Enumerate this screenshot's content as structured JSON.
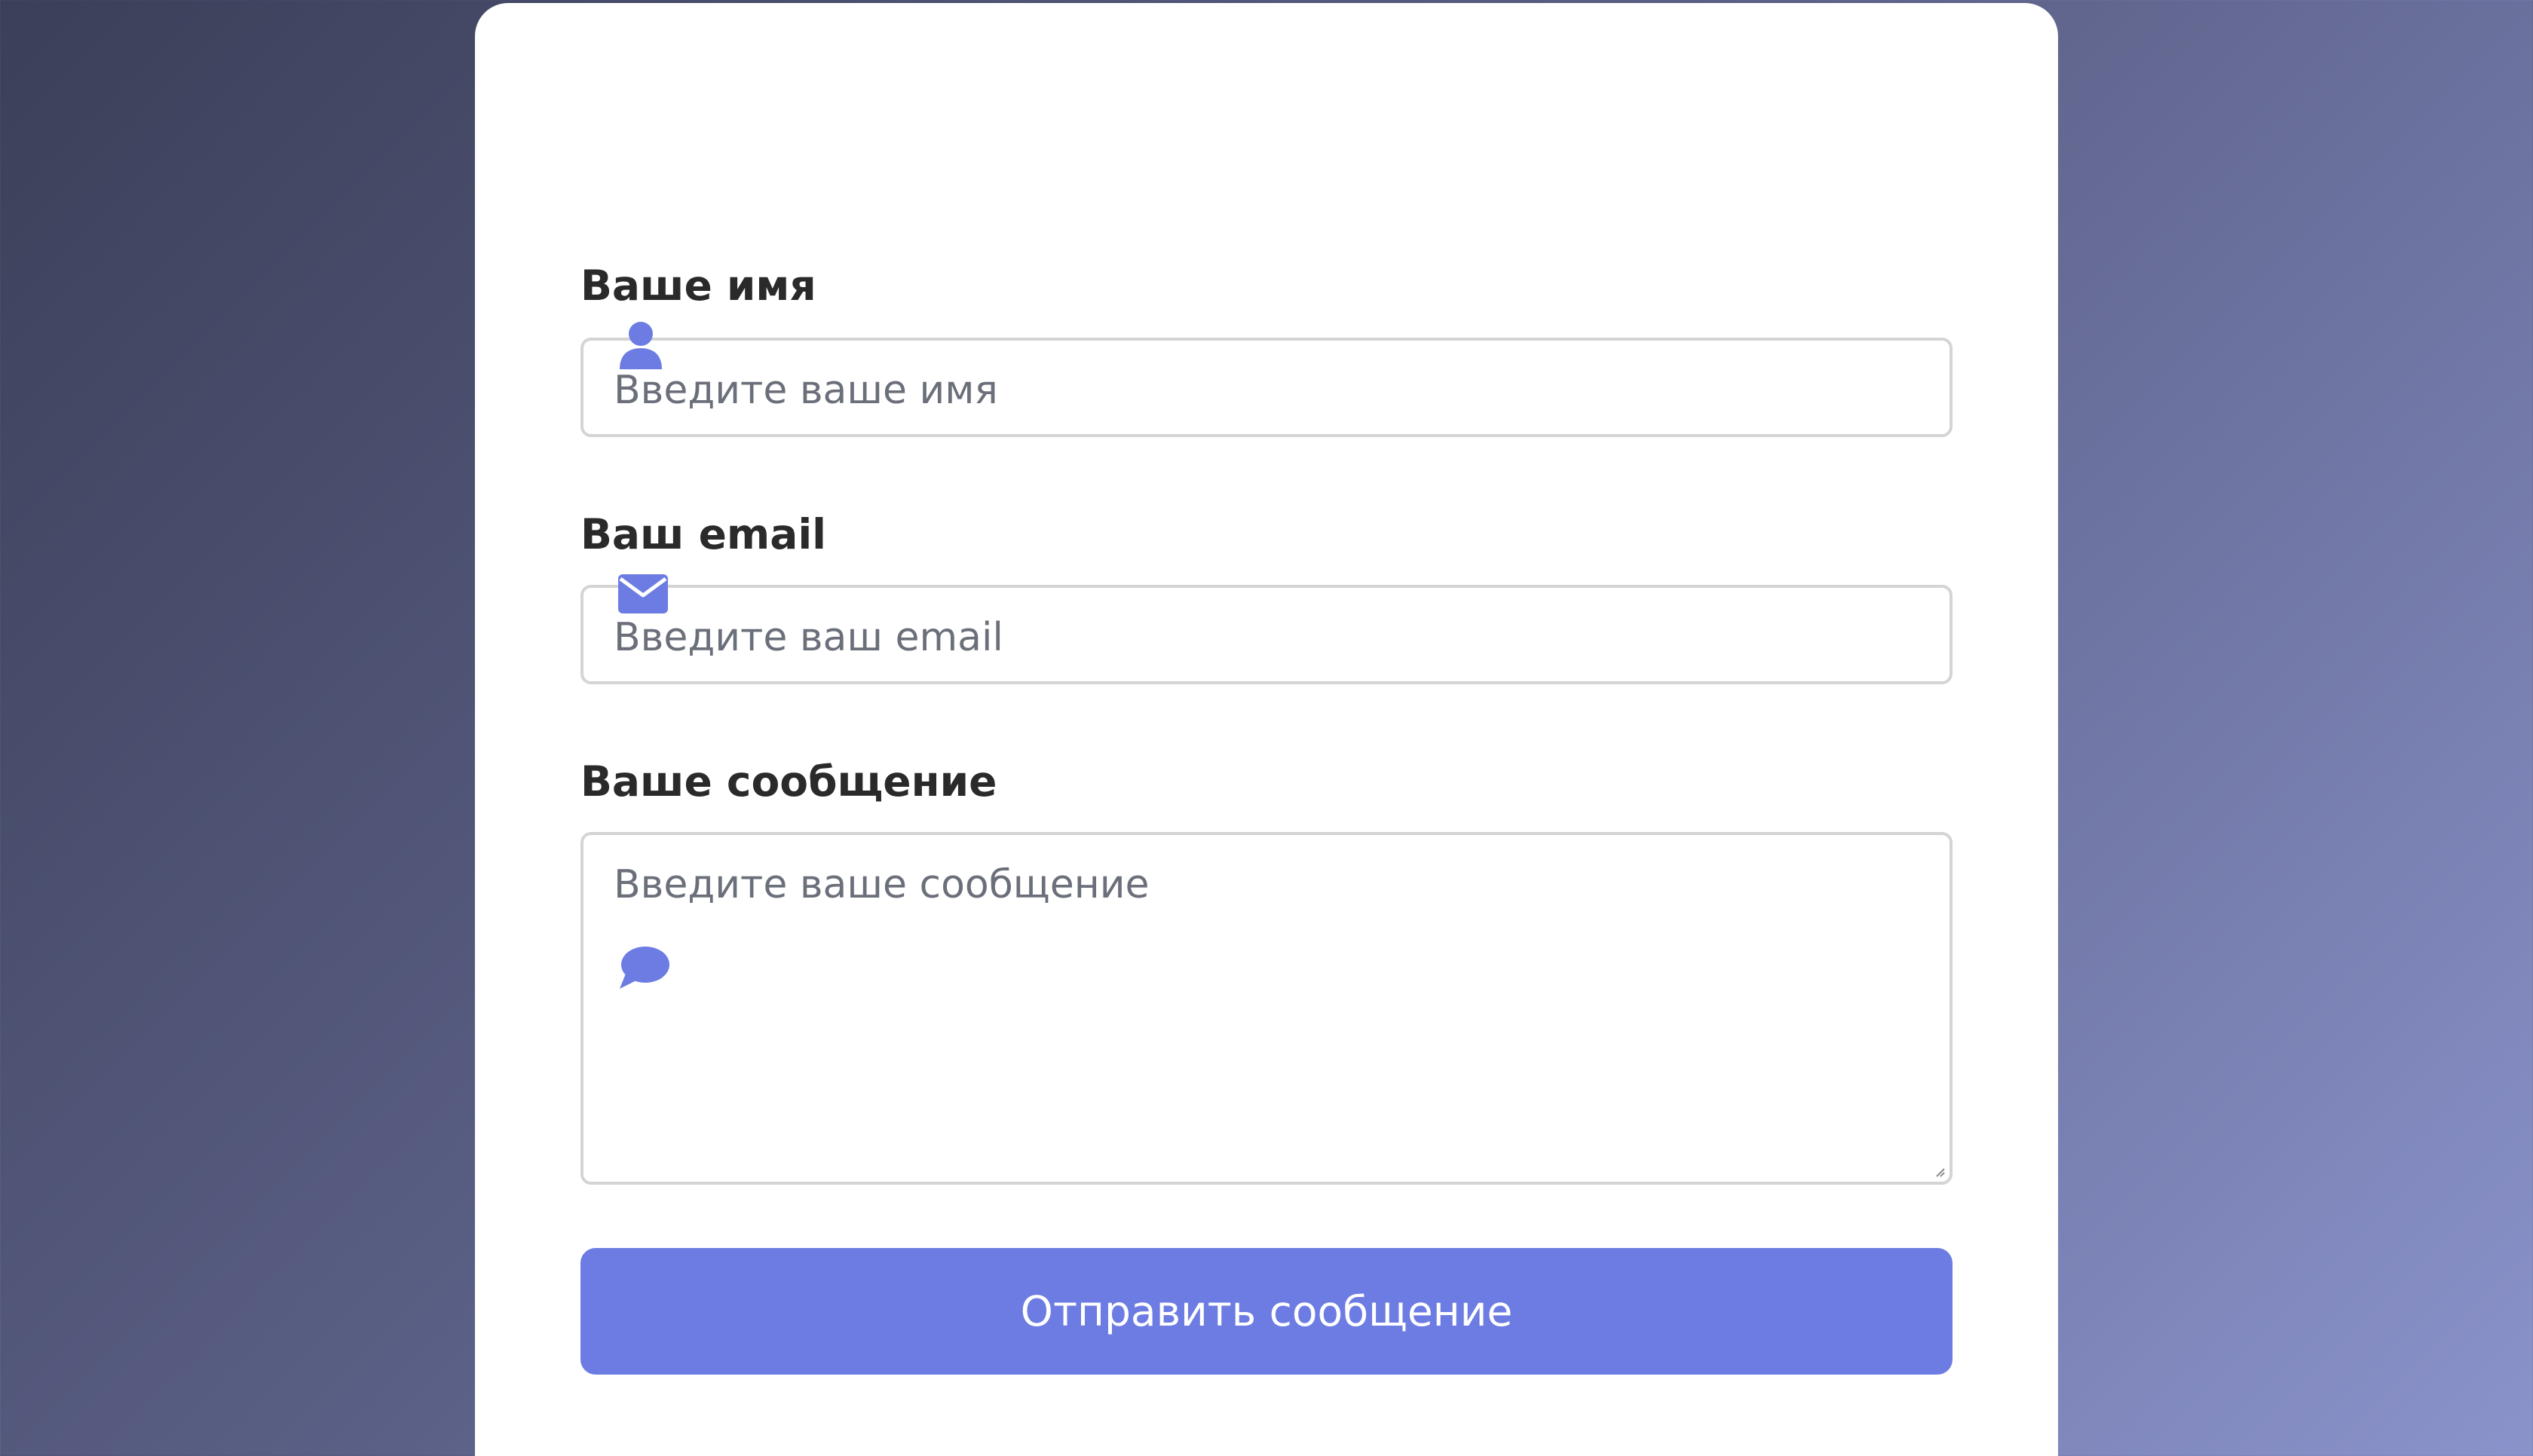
{
  "form": {
    "name": {
      "label": "Ваше имя",
      "placeholder": "Введите ваше имя",
      "icon": "user-icon"
    },
    "email": {
      "label": "Ваш email",
      "placeholder": "Введите ваш email",
      "icon": "envelope-icon"
    },
    "message": {
      "label": "Ваше сообщение",
      "placeholder": "Введите ваше сообщение",
      "icon": "speech-bubble-icon"
    },
    "submit_label": "Отправить сообщение"
  },
  "colors": {
    "accent": "#6c7ce2",
    "card": "#ffffff",
    "label": "#2a2a2a",
    "placeholder": "#6a6f7a",
    "border": "#d4d4d4"
  }
}
